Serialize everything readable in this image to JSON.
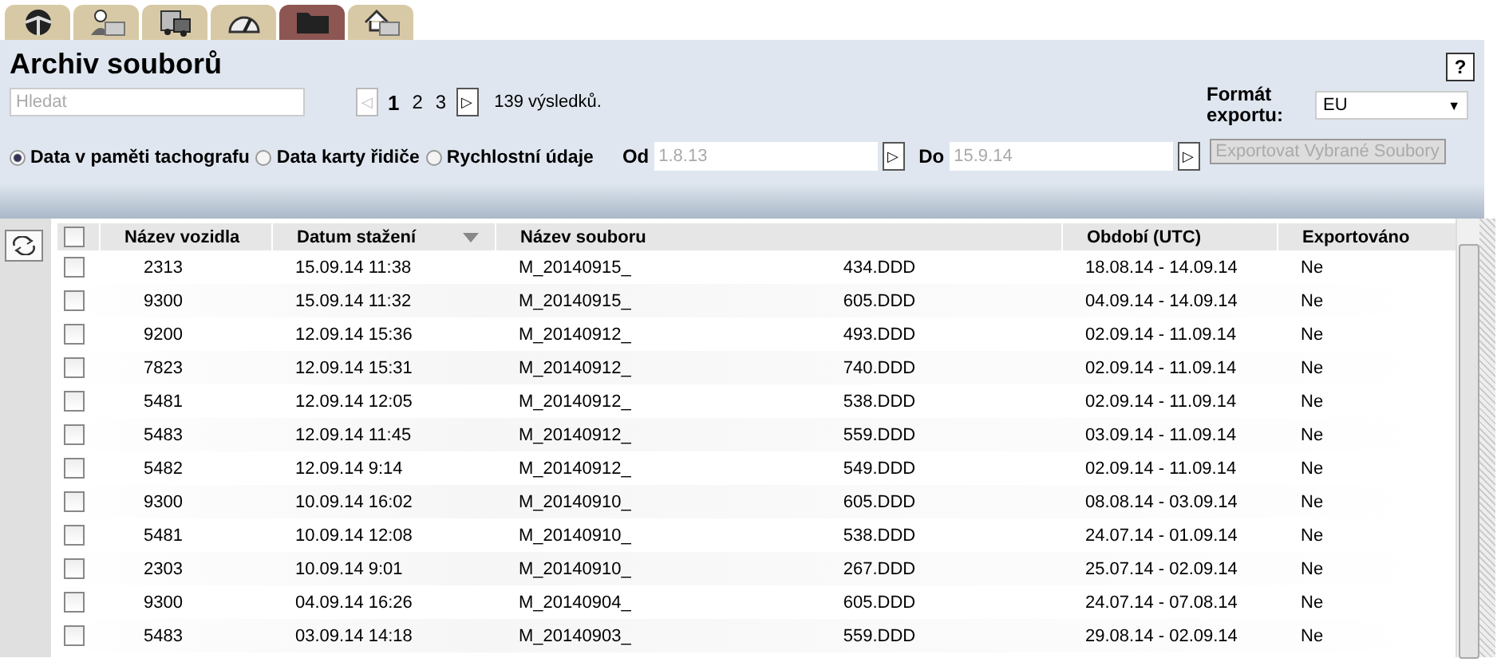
{
  "tabs": [
    {
      "kind": "wheel",
      "selected": false
    },
    {
      "kind": "driver",
      "selected": false
    },
    {
      "kind": "vehicle",
      "selected": false
    },
    {
      "kind": "gauge",
      "selected": false
    },
    {
      "kind": "folder",
      "selected": true
    },
    {
      "kind": "upload",
      "selected": false
    }
  ],
  "header": {
    "title": "Archiv souborů",
    "help": "?"
  },
  "search": {
    "placeholder": "Hledat"
  },
  "pager": {
    "prev": "◁",
    "next": "▷",
    "pages": [
      {
        "label": "1",
        "selected": true
      },
      {
        "label": "2",
        "selected": false
      },
      {
        "label": "3",
        "selected": false
      }
    ],
    "prev_disabled": true,
    "results": "139 výsledků."
  },
  "sources": [
    {
      "label": "Data v paměti tachografu",
      "selected": true
    },
    {
      "label": "Data karty řidiče",
      "selected": false
    },
    {
      "label": "Rychlostní údaje",
      "selected": false
    }
  ],
  "date_from": {
    "label": "Od",
    "placeholder": "1.8.13",
    "picker": "▷"
  },
  "date_to": {
    "label": "Do",
    "placeholder": "15.9.14",
    "picker": "▷"
  },
  "export": {
    "label": "Formát exportu:",
    "format": "EU",
    "caret": "▼",
    "button": "Exportovat Vybrané Soubory",
    "button_disabled": true
  },
  "table": {
    "select_all_checked": false,
    "columns": [
      {
        "label": "Název vozidla",
        "sorted": false
      },
      {
        "label": "Datum stažení",
        "sorted": true
      },
      {
        "label": "Název souboru",
        "sorted": false
      },
      {
        "label": "Období (UTC)",
        "sorted": false
      },
      {
        "label": "Exportováno",
        "sorted": false
      }
    ],
    "rows": [
      {
        "vehicle": "2313",
        "date": "15.09.14 11:38",
        "file": "M_20140915_",
        "file_end": "434.DDD",
        "period": "18.08.14 - 14.09.14",
        "exported": "Ne",
        "checked": false
      },
      {
        "vehicle": "9300",
        "date": "15.09.14 11:32",
        "file": "M_20140915_",
        "file_end": "605.DDD",
        "period": "04.09.14 - 14.09.14",
        "exported": "Ne",
        "checked": false
      },
      {
        "vehicle": "9200",
        "date": "12.09.14 15:36",
        "file": "M_20140912_",
        "file_end": "493.DDD",
        "period": "02.09.14 - 11.09.14",
        "exported": "Ne",
        "checked": false
      },
      {
        "vehicle": "7823",
        "date": "12.09.14 15:31",
        "file": "M_20140912_",
        "file_end": "740.DDD",
        "period": "02.09.14 - 11.09.14",
        "exported": "Ne",
        "checked": false
      },
      {
        "vehicle": "5481",
        "date": "12.09.14 12:05",
        "file": "M_20140912_",
        "file_end": "538.DDD",
        "period": "02.09.14 - 11.09.14",
        "exported": "Ne",
        "checked": false
      },
      {
        "vehicle": "5483",
        "date": "12.09.14 11:45",
        "file": "M_20140912_",
        "file_end": "559.DDD",
        "period": "03.09.14 - 11.09.14",
        "exported": "Ne",
        "checked": false
      },
      {
        "vehicle": "5482",
        "date": "12.09.14 9:14",
        "file": "M_20140912_",
        "file_end": "549.DDD",
        "period": "02.09.14 - 11.09.14",
        "exported": "Ne",
        "checked": false
      },
      {
        "vehicle": "9300",
        "date": "10.09.14 16:02",
        "file": "M_20140910_",
        "file_end": "605.DDD",
        "period": "08.08.14 - 03.09.14",
        "exported": "Ne",
        "checked": false
      },
      {
        "vehicle": "5481",
        "date": "10.09.14 12:08",
        "file": "M_20140910_",
        "file_end": "538.DDD",
        "period": "24.07.14 - 01.09.14",
        "exported": "Ne",
        "checked": false
      },
      {
        "vehicle": "2303",
        "date": "10.09.14 9:01",
        "file": "M_20140910_",
        "file_end": "267.DDD",
        "period": "25.07.14 - 02.09.14",
        "exported": "Ne",
        "checked": false
      },
      {
        "vehicle": "9300",
        "date": "04.09.14 16:26",
        "file": "M_20140904_",
        "file_end": "605.DDD",
        "period": "24.07.14 - 07.08.14",
        "exported": "Ne",
        "checked": false
      },
      {
        "vehicle": "5483",
        "date": "03.09.14 14:18",
        "file": "M_20140903_",
        "file_end": "559.DDD",
        "period": "29.08.14 - 02.09.14",
        "exported": "Ne",
        "checked": false
      }
    ]
  }
}
